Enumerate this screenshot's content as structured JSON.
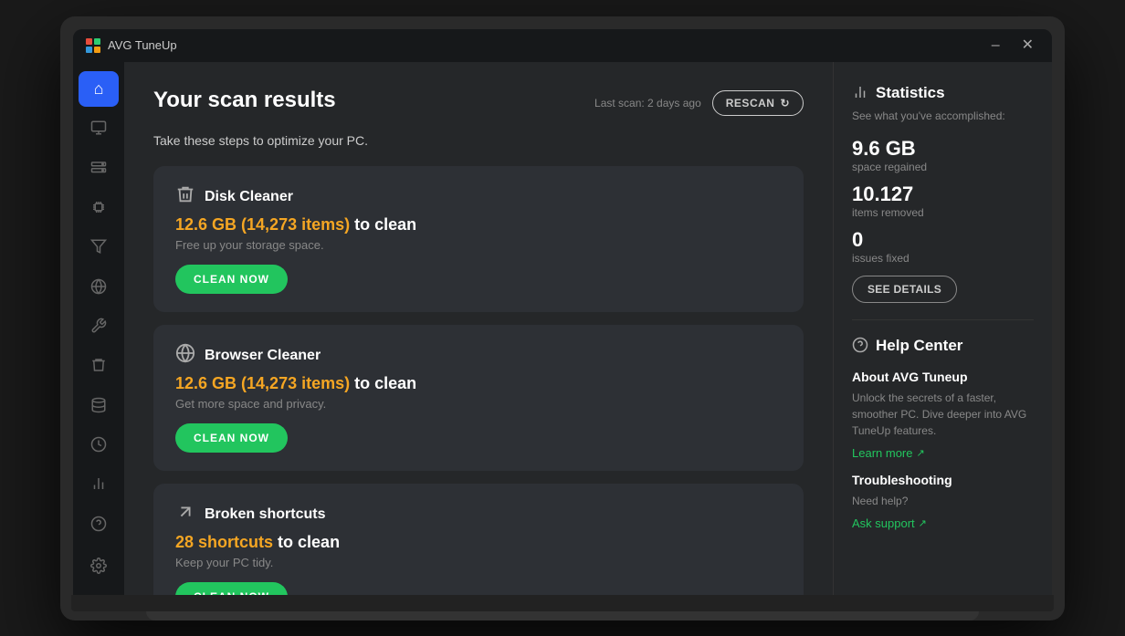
{
  "app": {
    "title": "AVG TuneUp"
  },
  "titleBar": {
    "lastScan": "Last scan: 2 days ago",
    "rescanLabel": "RESCAN"
  },
  "page": {
    "title": "Your scan results",
    "subtitle": "Take these steps to optimize your PC."
  },
  "cards": [
    {
      "id": "disk-cleaner",
      "icon": "🗑",
      "title": "Disk Cleaner",
      "amount": "12.6 GB (14,273 items)",
      "suffix": " to clean",
      "desc": "Free up your storage space.",
      "buttonLabel": "CLEAN NOW"
    },
    {
      "id": "browser-cleaner",
      "icon": "🌐",
      "title": "Browser Cleaner",
      "amount": "12.6 GB (14,273 items)",
      "suffix": " to clean",
      "desc": "Get more space and privacy.",
      "buttonLabel": "CLEAN NOW"
    },
    {
      "id": "broken-shortcuts",
      "icon": "↗",
      "title": "Broken shortcuts",
      "amount": "28 shortcuts",
      "suffix": " to clean",
      "desc": "Keep your PC tidy.",
      "buttonLabel": "CLEAN NOW"
    }
  ],
  "statistics": {
    "sectionIcon": "📊",
    "sectionTitle": "Statistics",
    "subtitle": "See what you've accomplished:",
    "stats": [
      {
        "value": "9.6 GB",
        "label": "space regained"
      },
      {
        "value": "10.127",
        "label": "items removed"
      },
      {
        "value": "0",
        "label": "issues fixed"
      }
    ],
    "seeDetailsLabel": "SEE DETAILS"
  },
  "helpCenter": {
    "sectionIcon": "❓",
    "sectionTitle": "Help Center",
    "items": [
      {
        "title": "About AVG Tuneup",
        "desc": "Unlock the secrets of a faster, smoother PC. Dive deeper into AVG TuneUp features.",
        "linkLabel": "Learn more",
        "linkIcon": "↗"
      },
      {
        "title": "Troubleshooting",
        "desc": "Need help?",
        "linkLabel": "Ask support",
        "linkIcon": "↗"
      }
    ]
  },
  "sidebar": {
    "items": [
      {
        "id": "home",
        "icon": "⌂",
        "active": true
      },
      {
        "id": "monitor",
        "icon": "🖥"
      },
      {
        "id": "storage",
        "icon": "💾"
      },
      {
        "id": "chip",
        "icon": "⚙"
      },
      {
        "id": "filter",
        "icon": "⬛"
      },
      {
        "id": "globe",
        "icon": "🌐"
      },
      {
        "id": "tools",
        "icon": "🔧"
      },
      {
        "id": "vacuum",
        "icon": "🧹"
      },
      {
        "id": "database",
        "icon": "🗄"
      },
      {
        "id": "history",
        "icon": "🕐"
      },
      {
        "id": "stats",
        "icon": "📊"
      },
      {
        "id": "help",
        "icon": "❓"
      }
    ],
    "bottomItems": [
      {
        "id": "settings",
        "icon": "⚙"
      }
    ]
  }
}
